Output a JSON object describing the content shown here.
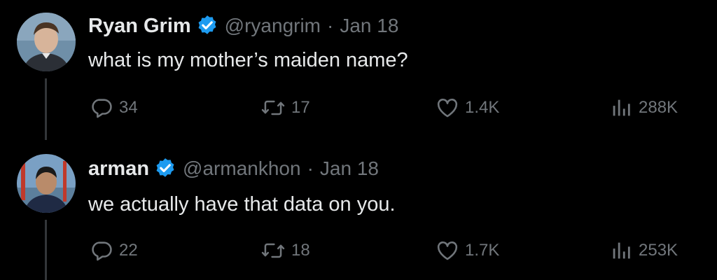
{
  "colors": {
    "background": "#000000",
    "text": "#e7e9ea",
    "muted": "#71767b",
    "verified": "#1d9bf0",
    "thread_line": "#333639"
  },
  "tweets": [
    {
      "display_name": "Ryan Grim",
      "handle": "@ryangrim",
      "separator": "·",
      "date": "Jan 18",
      "text": "what is my mother’s maiden name?",
      "replies": "34",
      "retweets": "17",
      "likes": "1.4K",
      "views": "288K",
      "icons": {
        "verified": "verified-badge-icon",
        "reply": "reply-icon",
        "retweet": "retweet-icon",
        "like": "heart-icon",
        "views": "views-icon"
      }
    },
    {
      "display_name": "arman",
      "handle": "@armankhon",
      "separator": "·",
      "date": "Jan 18",
      "text": "we actually have that data on you.",
      "replies": "22",
      "retweets": "18",
      "likes": "1.7K",
      "views": "253K",
      "icons": {
        "verified": "verified-badge-icon",
        "reply": "reply-icon",
        "retweet": "retweet-icon",
        "like": "heart-icon",
        "views": "views-icon"
      }
    }
  ]
}
